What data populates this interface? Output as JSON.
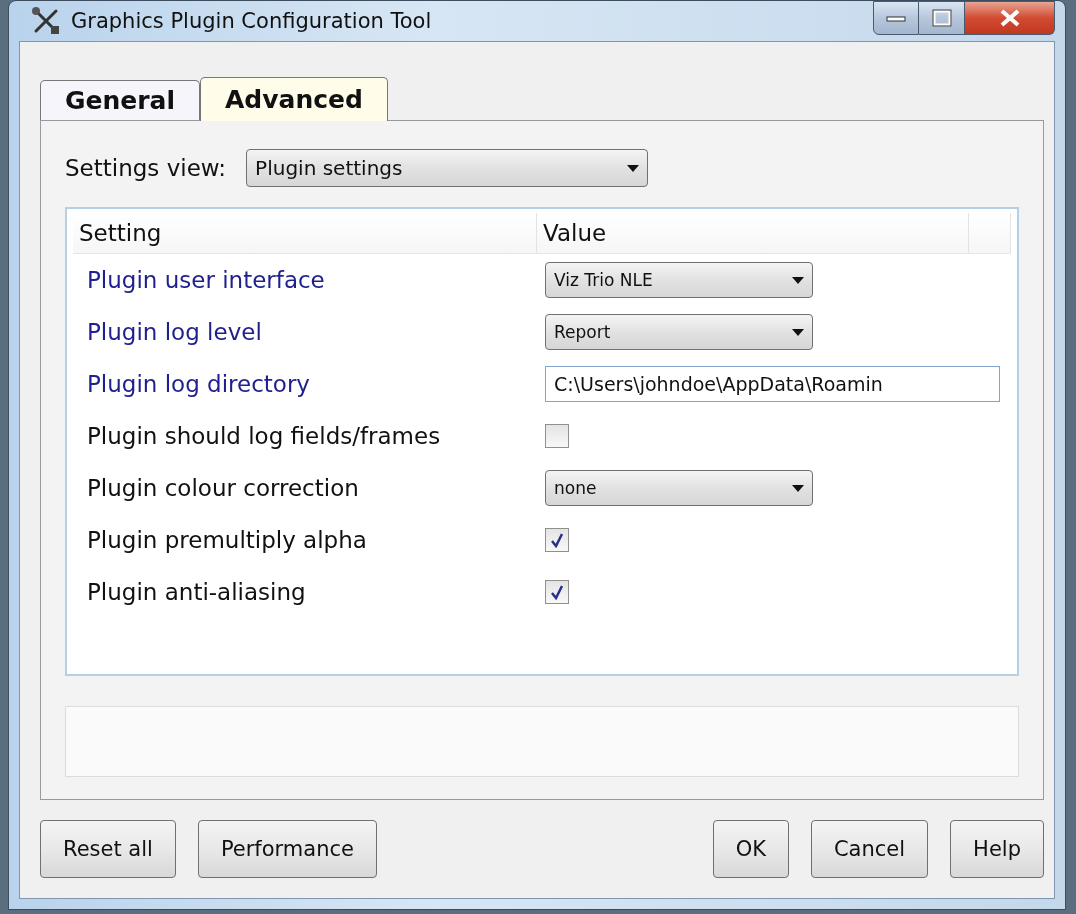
{
  "window": {
    "title": "Graphics Plugin Configuration Tool"
  },
  "tabs": [
    {
      "label": "General",
      "selected": false
    },
    {
      "label": "Advanced",
      "selected": true
    }
  ],
  "settings_view": {
    "label": "Settings view:",
    "value": "Plugin settings"
  },
  "table": {
    "columns": [
      "Setting",
      "Value"
    ],
    "rows": [
      {
        "label": "Plugin user interface",
        "highlighted": true,
        "kind": "dropdown",
        "value": "Viz Trio NLE"
      },
      {
        "label": "Plugin log level",
        "highlighted": true,
        "kind": "dropdown",
        "value": "Report"
      },
      {
        "label": "Plugin log directory",
        "highlighted": true,
        "kind": "text",
        "value": "C:\\Users\\johndoe\\AppData\\Roamin"
      },
      {
        "label": "Plugin should log fields/frames",
        "highlighted": false,
        "kind": "checkbox",
        "checked": false
      },
      {
        "label": "Plugin colour correction",
        "highlighted": false,
        "kind": "dropdown",
        "value": "none"
      },
      {
        "label": "Plugin premultiply alpha",
        "highlighted": false,
        "kind": "checkbox",
        "checked": true
      },
      {
        "label": "Plugin anti-aliasing",
        "highlighted": false,
        "kind": "checkbox",
        "checked": true
      }
    ]
  },
  "buttons_left": [
    "Reset all",
    "Performance"
  ],
  "buttons_right": [
    "OK",
    "Cancel",
    "Help"
  ]
}
